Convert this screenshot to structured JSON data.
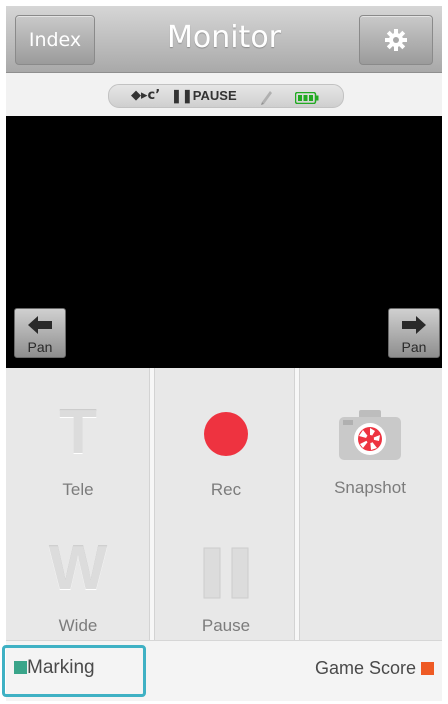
{
  "header": {
    "index_label": "Index",
    "title": "Monitor",
    "settings_icon": "gear-icon"
  },
  "status": {
    "link_text": "◆▸c’",
    "pause_text": "❚❚PAUSE",
    "battery_color": "#22aa22"
  },
  "viewer": {
    "pan_left_label": "Pan",
    "pan_right_label": "Pan"
  },
  "controls": {
    "tele": {
      "glyph": "T",
      "label": "Tele"
    },
    "rec": {
      "label": "Rec",
      "color": "#ee3340"
    },
    "snapshot": {
      "label": "Snapshot"
    },
    "wide": {
      "glyph": "W",
      "label": "Wide"
    },
    "pause": {
      "label": "Pause"
    }
  },
  "footer": {
    "marking_label": "Marking",
    "marking_color": "#3aa58a",
    "game_score_label": "Game Score",
    "game_score_color": "#ee5a24",
    "highlight_color": "#3fb1c4"
  }
}
